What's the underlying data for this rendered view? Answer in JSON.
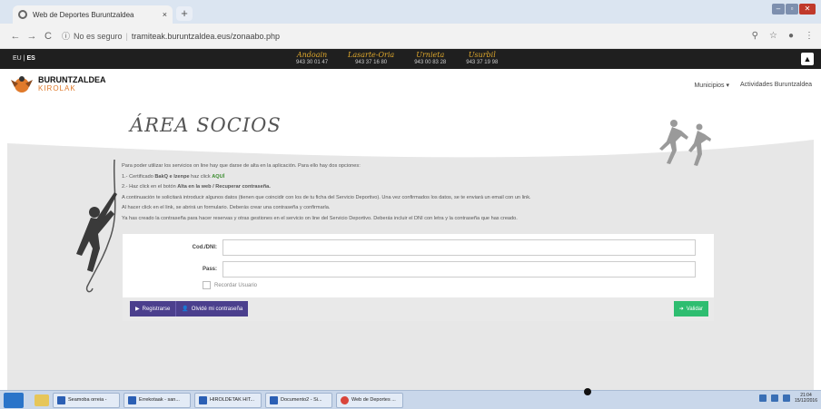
{
  "browser": {
    "tab_title": "Web de Deportes Buruntzaldea",
    "tab_close": "×",
    "new_tab": "+",
    "security": "No es seguro",
    "url": "tramiteak.buruntzaldea.eus/zonaabo.php",
    "nav_back": "←",
    "nav_forward": "→",
    "nav_reload": "C",
    "info_icon": "ⓘ",
    "zoom_icon": "⚲",
    "star_icon": "☆",
    "account_icon": "●",
    "menu_icon": "⋮",
    "win_min": "–",
    "win_max": "▫",
    "win_close": "✕"
  },
  "topbar": {
    "lang_eu": "EU",
    "lang_sep": "|",
    "lang_es": "ES",
    "phones": [
      {
        "name": "Andoain",
        "number": "943 30 01 47"
      },
      {
        "name": "Lasarte-Oria",
        "number": "943 37 16 80"
      },
      {
        "name": "Urnieta",
        "number": "943 00 83 28"
      },
      {
        "name": "Usurbil",
        "number": "943 37 19 98"
      }
    ],
    "user_icon": "▲"
  },
  "site": {
    "logo_line1": "BURUNTZALDEA",
    "logo_line2": "KIROLAK",
    "menu": [
      "Municipios ▾",
      "Actividades Buruntzaldea"
    ]
  },
  "page": {
    "title": "ÁREA SOCIOS",
    "intro_1": "Para poder utilizar los servicios on line hay que darse de alta en la aplicación. Para ello hay dos opciones:",
    "intro_2_prefix": "1.- Certificado ",
    "intro_2_bold": "BakQ e Izenpe",
    "intro_2_mid": " haz click ",
    "intro_2_link": "AQUÍ",
    "intro_3_prefix": "2.- Haz click en el botón ",
    "intro_3_bold": "Alta en la web / Recuperar contraseña.",
    "intro_4": "A continuación te solicitará introducir algunos datos (tienen que coincidir con los de tu ficha del Servicio Deportivo). Una vez confirmados los datos, se te enviará un email con un link.",
    "intro_5": "Al hacer click en el link, se abrirá un formulario. Deberás crear una contraseña y confirmarla.",
    "intro_6": "Ya has creado la contraseña para hacer reservas y otras gestiones en el servicio on line del Servicio Deportivo. Deberás incluir el DNI con letra y la contraseña que has creado."
  },
  "form": {
    "dni_label": "Cod./DNI:",
    "dni_value": "",
    "pass_label": "Pass:",
    "pass_value": "",
    "remember_label": "Recordar Usuario",
    "register_label": "Registrarse",
    "forgot_label": "Olvidé mi contraseña",
    "submit_label": "Validar",
    "register_icon": "▶",
    "forgot_icon": "👤",
    "submit_icon": "➜"
  },
  "taskbar": {
    "items": [
      {
        "label": "Seamoba orreia -",
        "icon": "ie"
      },
      {
        "label": "Errekotaak - san...",
        "icon": "ie"
      },
      {
        "label": "HIROLDETAK HIT...",
        "icon": "doc"
      },
      {
        "label": "Documento2 - Si...",
        "icon": "doc"
      },
      {
        "label": "Web de Deportes ...",
        "icon": "chrome"
      }
    ],
    "time": "21:04",
    "date": "15/12/2016"
  },
  "colors": {
    "accent_purple": "#4b3f8d",
    "accent_green": "#2ebd70",
    "link_green": "#3a8c2e",
    "phone_gold": "#e0a92d",
    "logo_orange": "#e07a2b"
  }
}
